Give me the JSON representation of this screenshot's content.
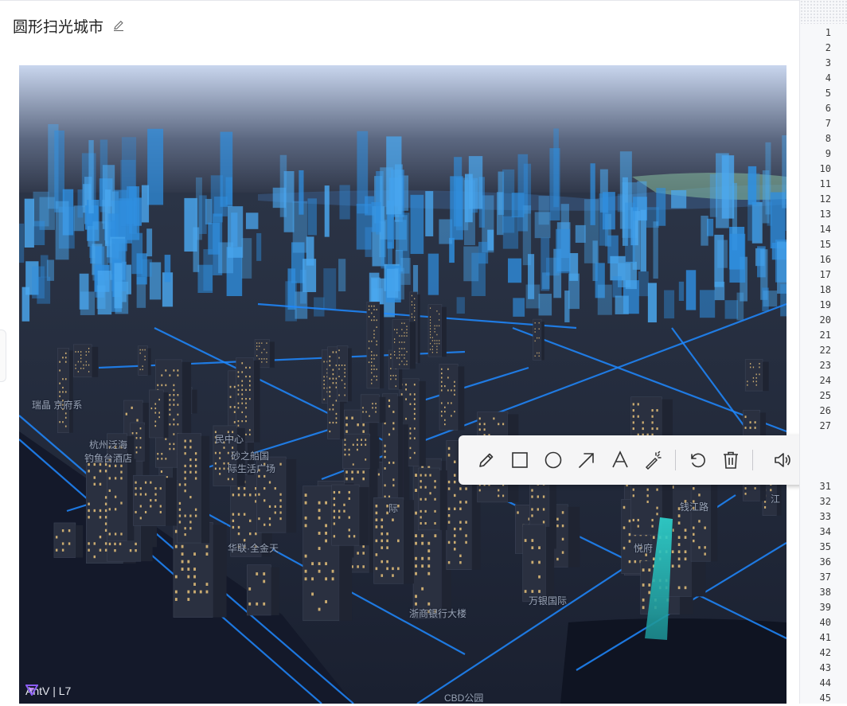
{
  "page": {
    "title": "圆形扫光城市",
    "edit_icon": "pencil-icon"
  },
  "map": {
    "logo_text": "AntV | L7",
    "labels": [
      "瑞晶 京府系",
      "杭州泛海",
      "钓鱼台酒店",
      "民中心",
      "砂之船国",
      "际生活广场",
      "华联·全金天",
      "浙商银行大楼",
      "万银国际",
      "CBD公园",
      "钱江路",
      "悦府",
      "江 ",
      "际"
    ]
  },
  "toolbar": {
    "buttons": [
      {
        "name": "pencil-tool",
        "icon": "pencil-icon"
      },
      {
        "name": "rectangle-tool",
        "icon": "square-icon"
      },
      {
        "name": "circle-tool",
        "icon": "circle-icon"
      },
      {
        "name": "arrow-tool",
        "icon": "arrow-icon"
      },
      {
        "name": "text-tool",
        "icon": "text-a-icon"
      },
      {
        "name": "magic-wand-tool",
        "icon": "magic-wand-icon"
      },
      {
        "name": "undo-button",
        "icon": "undo-icon"
      },
      {
        "name": "delete-button",
        "icon": "trash-icon"
      },
      {
        "name": "audio-button",
        "icon": "speaker-icon"
      },
      {
        "name": "mic-button",
        "icon": "microphone-icon"
      }
    ]
  },
  "gutter": {
    "lines": [
      "1",
      "2",
      "3",
      "4",
      "5",
      "6",
      "7",
      "8",
      "9",
      "10",
      "11",
      "12",
      "13",
      "14",
      "15",
      "16",
      "17",
      "18",
      "19",
      "20",
      "21",
      "22",
      "23",
      "24",
      "25",
      "26",
      "27",
      "31",
      "32",
      "33",
      "34",
      "35",
      "36",
      "37",
      "38",
      "39",
      "40",
      "41",
      "42",
      "43",
      "44",
      "45"
    ]
  },
  "colors": {
    "building_blue": "#2f8fe0",
    "road_blue": "#1e88ff",
    "map_bg": "#1b2233",
    "window_light": "#e8c27a",
    "teal_column": "#22c7c7"
  }
}
